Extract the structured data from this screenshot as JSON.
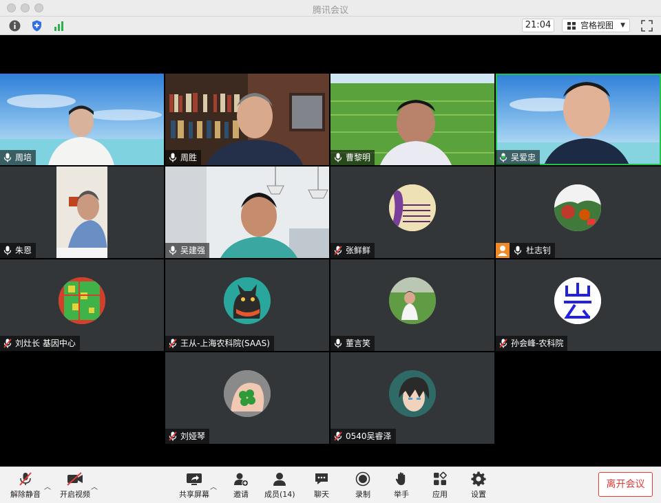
{
  "window": {
    "title": "腾讯会议"
  },
  "topbar": {
    "time": "21:04",
    "view_label": "宫格视图"
  },
  "participants": [
    {
      "name": "周培",
      "mic": "on"
    },
    {
      "name": "周胜",
      "mic": "on"
    },
    {
      "name": "曹黎明",
      "mic": "on"
    },
    {
      "name": "吴爱忠",
      "mic": "speaking"
    },
    {
      "name": "朱恩",
      "mic": "on"
    },
    {
      "name": "吴建强",
      "mic": "on"
    },
    {
      "name": "张鲜鲜",
      "mic": "muted"
    },
    {
      "name": "杜志钊",
      "mic": "on",
      "host": true
    },
    {
      "name": "刘灶长  基因中心",
      "mic": "muted"
    },
    {
      "name": "王从-上海农科院(SAAS)",
      "mic": "muted"
    },
    {
      "name": "董言笑",
      "mic": "on"
    },
    {
      "name": "孙会峰-农科院",
      "mic": "muted"
    },
    {
      "name": "刘娅琴",
      "mic": "muted"
    },
    {
      "name": "0540吴睿泽",
      "mic": "muted"
    }
  ],
  "toolbar": {
    "unmute": "解除静音",
    "start_video": "开启视频",
    "share_screen": "共享屏幕",
    "invite": "邀请",
    "members": "成员(14)",
    "chat": "聊天",
    "record": "录制",
    "raise_hand": "举手",
    "apps": "应用",
    "settings": "设置",
    "leave": "离开会议"
  },
  "colors": {
    "speaking": "#23c34a",
    "muted": "#e53935",
    "leave": "#e53935",
    "host_badge": "#f08a24"
  }
}
